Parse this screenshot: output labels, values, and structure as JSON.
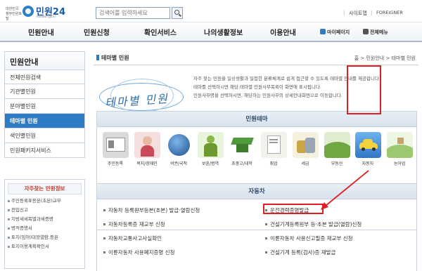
{
  "header": {
    "gov_text": "대한민국 정부민원포털",
    "logo_name": "민원24",
    "logo_url": "minwon.go.kr",
    "search_placeholder": "검색어를 입력하세요",
    "sitemap": "사이트맵",
    "foreigner": "FOREIGNER"
  },
  "gnb": {
    "items": [
      "민원안내",
      "민원신청",
      "확인서비스",
      "나의생활정보",
      "이용안내"
    ],
    "mypage": "마이페이지",
    "allmenu": "전체메뉴"
  },
  "lnb": {
    "title": "민원안내",
    "items": [
      "전체민원검색",
      "기관별민원",
      "분야별민원",
      "테마별 민원",
      "색인별민원",
      "민원패키지서비스"
    ]
  },
  "fav": {
    "title": "자주찾는 민원정보",
    "items": [
      "주민등록표등본(초본)교부",
      "전입신고",
      "지방세세목별과세증명",
      "병적증명서",
      "토지(임야)대장열람.등본",
      "토지이용계획확인서"
    ]
  },
  "page": {
    "title": "테마별 민원",
    "breadcrumb": [
      "홈",
      "민원안내",
      "테마별 민원"
    ],
    "banner_title": "테마별 민원",
    "banner_desc": [
      "자주 찾는 민원을 일상생활과 밀접한 분류체계로 쉽게 접근할 수 있도록 테마별 안내를 제공합니다.",
      "테마를 선택하시면 해당 테마별 민원사무목록이 화면에 표시됩니다.",
      "민원사무명을 선택하시면, 해당하는 민원사무의 상세안내화면으로 이동합니다."
    ]
  },
  "themes": {
    "title": "민원테마",
    "items": [
      {
        "label": "주민등록",
        "icon": "id-card-icon",
        "color": "#d9d9d9"
      },
      {
        "label": "복지/장애인",
        "icon": "welfare-icon",
        "color": "#f4dede"
      },
      {
        "label": "여권/국적",
        "icon": "globe-icon",
        "color": "#2f6db0"
      },
      {
        "label": "보훈/병역",
        "icon": "soldier-icon",
        "color": "#7fae3b"
      },
      {
        "label": "초중고/대학",
        "icon": "graduation-cap-icon",
        "color": "#4f9a3c"
      },
      {
        "label": "취업",
        "icon": "document-icon",
        "color": "#d7d2c8"
      },
      {
        "label": "세금",
        "icon": "coins-icon",
        "color": "#c9b77a"
      },
      {
        "label": "부동산",
        "icon": "hill-icon",
        "color": "#6fa83e"
      },
      {
        "label": "자동차",
        "icon": "car-icon",
        "color": "#3a8ad6"
      },
      {
        "label": "농어업",
        "icon": "farm-icon",
        "color": "#9cc870"
      }
    ]
  },
  "car": {
    "title": "자동차",
    "left": [
      "자동차 등록원부등본(초본) 발급·열람신청",
      "자동차등록증 재교부 신청",
      "자동차교통사고사실확인",
      "이륜자동차 사용폐지증명 신청"
    ],
    "right": [
      "운전경력증명발급",
      "건설기계등록원부 등·초본 발급(열람)신청",
      "이륜자동차 사용신고필증 재교부 신청",
      "건설기계 등록(검사)증 재발급"
    ]
  }
}
